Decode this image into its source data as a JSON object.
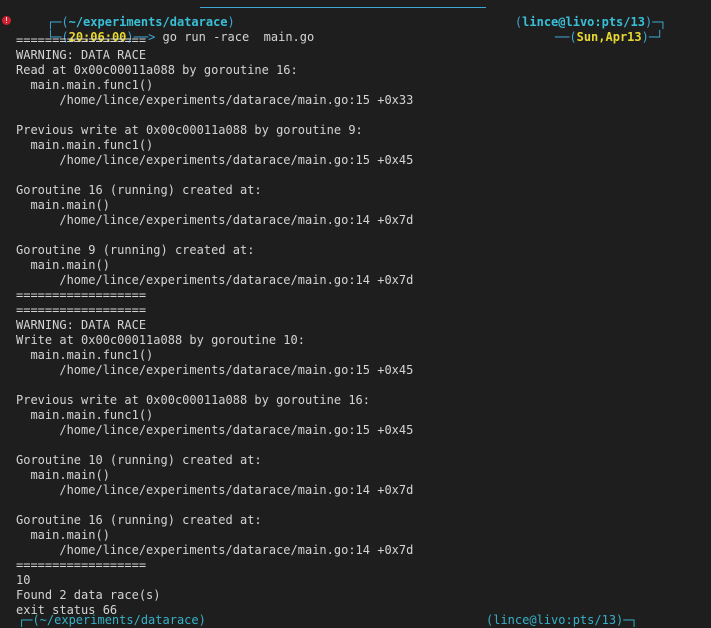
{
  "prompt": {
    "path_open": "┌─(",
    "path": "~/experiments/datarace",
    "path_close": ")",
    "user_open": "(",
    "user": "lince@livo:pts/13",
    "user_close": ")─┐",
    "second_open": "└─(",
    "time": "20:06:00",
    "second_close": ")──> ",
    "command": "go run -race  main.go",
    "date_open": "──(",
    "date": "Sun,Apr13",
    "date_close": ")─┘",
    "status_icon": "error-dot-icon"
  },
  "output_lines": [
    "==================",
    "WARNING: DATA RACE",
    "Read at 0x00c00011a088 by goroutine 16:",
    "  main.main.func1()",
    "      /home/lince/experiments/datarace/main.go:15 +0x33",
    "",
    "Previous write at 0x00c00011a088 by goroutine 9:",
    "  main.main.func1()",
    "      /home/lince/experiments/datarace/main.go:15 +0x45",
    "",
    "Goroutine 16 (running) created at:",
    "  main.main()",
    "      /home/lince/experiments/datarace/main.go:14 +0x7d",
    "",
    "Goroutine 9 (running) created at:",
    "  main.main()",
    "      /home/lince/experiments/datarace/main.go:14 +0x7d",
    "==================",
    "==================",
    "WARNING: DATA RACE",
    "Write at 0x00c00011a088 by goroutine 10:",
    "  main.main.func1()",
    "      /home/lince/experiments/datarace/main.go:15 +0x45",
    "",
    "Previous write at 0x00c00011a088 by goroutine 16:",
    "  main.main.func1()",
    "      /home/lince/experiments/datarace/main.go:15 +0x45",
    "",
    "Goroutine 10 (running) created at:",
    "  main.main()",
    "      /home/lince/experiments/datarace/main.go:14 +0x7d",
    "",
    "Goroutine 16 (running) created at:",
    "  main.main()",
    "      /home/lince/experiments/datarace/main.go:14 +0x7d",
    "==================",
    "10",
    "Found 2 data race(s)",
    "exit status 66"
  ],
  "next_prompt": {
    "path": "┌─(~/experiments/datarace)",
    "user": "(lince@livo:pts/13)─┐"
  },
  "colors": {
    "background": "#1e1e1e",
    "text": "#d4d4d4",
    "frame": "#3ea8d8",
    "accent_cyan": "#38c0d8",
    "accent_yellow": "#e6d830",
    "error": "#d02030"
  }
}
